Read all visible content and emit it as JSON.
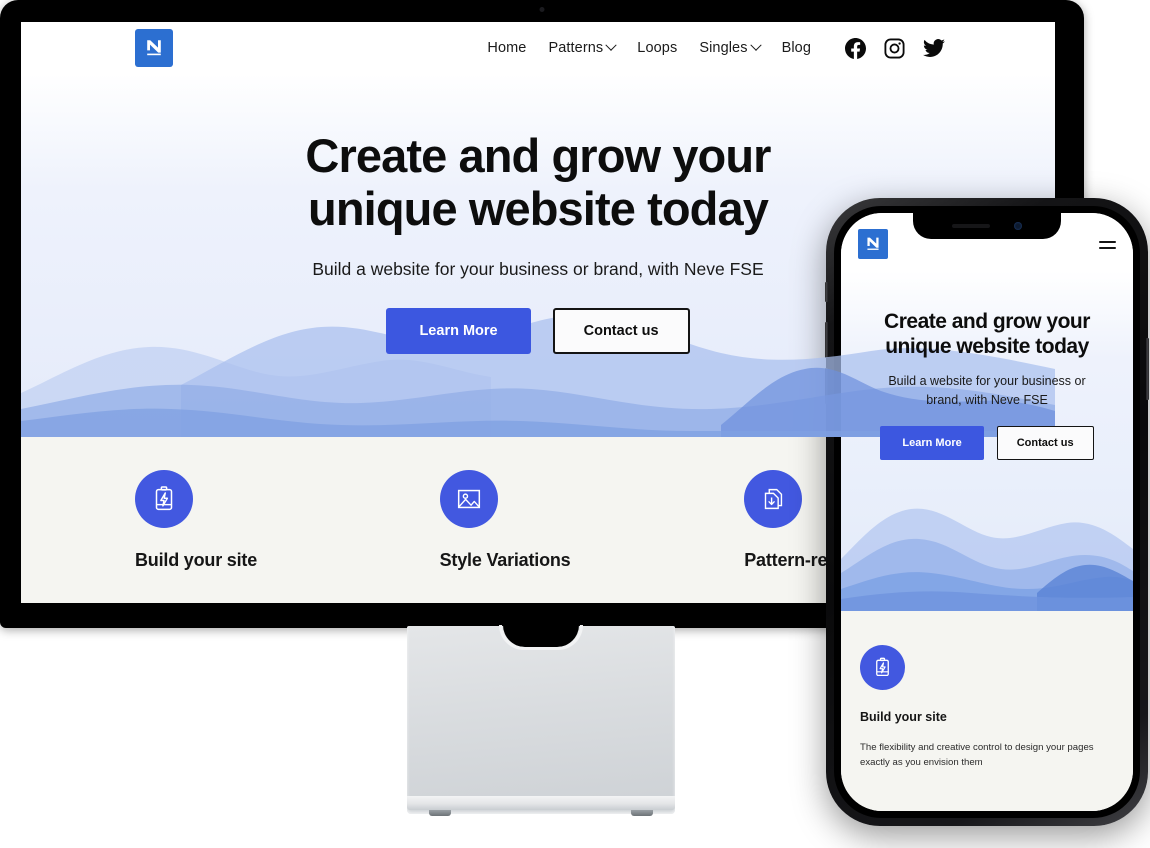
{
  "brand": {
    "logo_letter": "N",
    "logo_color": "#2c6fd1",
    "accent_color": "#3c57e0",
    "icon_circle_color": "#4258e0",
    "features_bg": "#f5f5f1"
  },
  "desktop": {
    "nav": {
      "items": [
        {
          "label": "Home",
          "has_dropdown": false
        },
        {
          "label": "Patterns",
          "has_dropdown": true
        },
        {
          "label": "Loops",
          "has_dropdown": false
        },
        {
          "label": "Singles",
          "has_dropdown": true
        },
        {
          "label": "Blog",
          "has_dropdown": false
        }
      ],
      "social": [
        {
          "name": "facebook-icon"
        },
        {
          "name": "instagram-icon"
        },
        {
          "name": "twitter-icon"
        }
      ]
    },
    "hero": {
      "title": "Create and grow your unique website today",
      "subtitle": "Build a website for your business or brand, with Neve FSE",
      "primary_button": "Learn More",
      "secondary_button": "Contact us"
    },
    "features": [
      {
        "icon": "battery-bolt-icon",
        "title": "Build your site"
      },
      {
        "icon": "image-landscape-icon",
        "title": "Style Variations"
      },
      {
        "icon": "documents-download-icon",
        "title": "Pattern-ready"
      }
    ]
  },
  "mobile": {
    "logo_letter": "N",
    "menu_icon": "hamburger-menu-icon",
    "hero": {
      "title": "Create and grow your unique website today",
      "subtitle": "Build a website for your business or brand, with Neve FSE",
      "primary_button": "Learn More",
      "secondary_button": "Contact us"
    },
    "feature": {
      "icon": "battery-bolt-icon",
      "title": "Build your site",
      "description": "The flexibility and creative control to design your pages exactly as you envision them"
    }
  }
}
